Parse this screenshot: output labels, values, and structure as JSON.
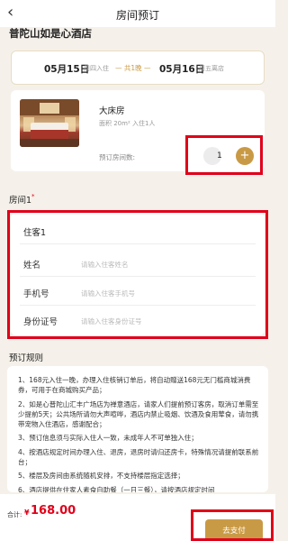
{
  "header": {
    "title": "房间预订",
    "back_icon": "chevron-left-icon"
  },
  "hotel": {
    "name": "普陀山如是心酒店"
  },
  "dates": {
    "checkin_date": "05月15日",
    "checkin_week": "周四入住",
    "nights": "— 共1晚 —",
    "checkout_date": "05月16日",
    "checkout_week": "周五离店"
  },
  "room": {
    "name": "大床房",
    "info": "面积 20m² 入住1人",
    "count_label": "预订房间数:",
    "count_value": "1",
    "plus_symbol": "+"
  },
  "guests": {
    "section_title": "房间1",
    "required_mark": "*",
    "guest_title": "住客1",
    "fields": [
      {
        "label": "姓名",
        "placeholder": "请输入住客姓名"
      },
      {
        "label": "手机号",
        "placeholder": "请输入住客手机号"
      },
      {
        "label": "身份证号",
        "placeholder": "请输入住客身份证号"
      }
    ]
  },
  "rules": {
    "title": "预订规则",
    "items": [
      "1、168元入住一晚，办理入住核销订单后，将自动赠送168元无门槛商城消费券，可用于在商城购买产品；",
      "2、如是心普陀山汇丰广场店为禅意酒店，请家人们提前预订客房，取消订单需至少提前5天；公共场所请勿大声喧哗，酒店内禁止吸烟、饮酒及食用荤食，请勿携带宠物入住酒店，感谢配合；",
      "3、预订信息须与实际入住人一致，未成年人不可单独入住；",
      "4、按酒店规定时间办理入住、退房，退房时请归还房卡，特殊情况请提前联系前台；",
      "5、楼层及房间由系统随机安排，不支持楼层指定选择；",
      "6、酒店提供在住家人素食自助餐（一日三餐），请按酒店规定时间"
    ]
  },
  "footer": {
    "total_label": "合计:",
    "currency": "¥",
    "total": "168.00",
    "pay_label": "去支付"
  },
  "colors": {
    "accent": "#c99a45",
    "highlight": "#e0001a",
    "price": "#e0001a"
  }
}
